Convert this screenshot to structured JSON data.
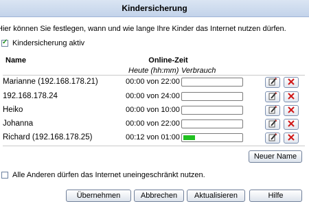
{
  "title": "Kindersicherung",
  "intro": "Hier können Sie festlegen, wann und wie lange Ihre Kinder das Internet nutzen dürfen.",
  "active_checkbox": {
    "label": "Kindersicherung aktiv",
    "checked": true
  },
  "table": {
    "col_name": "Name",
    "col_online": "Online-Zeit",
    "col_today": "Heute (hh:mm)",
    "col_usage": "Verbrauch",
    "rows": [
      {
        "name": "Marianne  (192.168.178.21)",
        "time": "00:00 von 22:00",
        "usage": 0
      },
      {
        "name": "192.168.178.24",
        "time": "00:00 von 24:00",
        "usage": 0
      },
      {
        "name": " Heiko",
        "time": "00:00 von 10:00",
        "usage": 0
      },
      {
        "name": "Johanna",
        "time": "00:00 von 22:00",
        "usage": 0
      },
      {
        "name": "Richard  (192.168.178.25)",
        "time": "00:12 von 01:00",
        "usage": 0.2
      }
    ]
  },
  "new_name_button": "Neuer Name",
  "all_others_checkbox": {
    "label": "Alle Anderen dürfen das Internet uneingeschränkt nutzen.",
    "checked": false
  },
  "footer_buttons": {
    "apply": "Übernehmen",
    "cancel": "Abbrechen",
    "refresh": "Aktualisieren",
    "help": "Hilfe"
  },
  "icons": {
    "edit": "edit-pencil-icon",
    "delete": "delete-x-icon"
  },
  "colors": {
    "usage_fill": "#20c020",
    "delete_x": "#d01818",
    "header_bg": "#c3d3ea"
  }
}
